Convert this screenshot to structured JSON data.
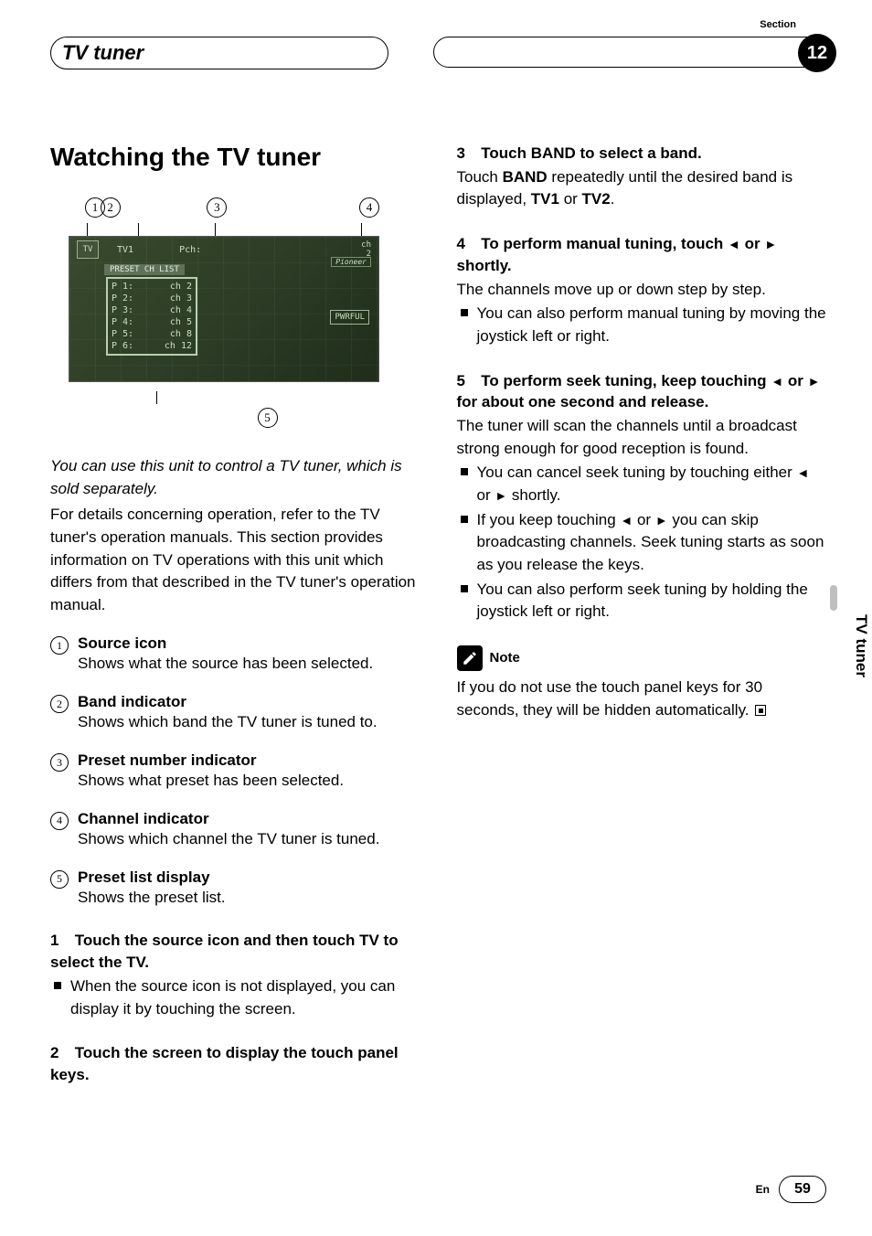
{
  "header": {
    "title": "TV tuner",
    "section_label": "Section",
    "section_number": "12"
  },
  "side_tab": "TV tuner",
  "col_left": {
    "heading": "Watching the TV tuner",
    "callouts_top": [
      "1",
      "2",
      "3",
      "4"
    ],
    "callout_bottom": "5",
    "screen": {
      "icon_label": "TV",
      "band": "TV1",
      "pch": "Pch:",
      "ch_label": "ch",
      "ch_value": "2",
      "brand": "Pioneer",
      "list_label": "PRESET CH LIST",
      "pwrful": "PWRFUL",
      "presets": [
        {
          "p": "P 1:",
          "ch": "ch   2"
        },
        {
          "p": "P 2:",
          "ch": "ch   3"
        },
        {
          "p": "P 3:",
          "ch": "ch   4"
        },
        {
          "p": "P 4:",
          "ch": "ch   5"
        },
        {
          "p": "P 5:",
          "ch": "ch   8"
        },
        {
          "p": "P 6:",
          "ch": "ch  12"
        }
      ]
    },
    "intro_italic": "You can use this unit to control a TV tuner, which is sold separately.",
    "intro_body": "For details concerning operation, refer to the TV tuner's operation manuals. This section provides information on TV operations with this unit which differs from that described in the TV tuner's operation manual.",
    "defs": [
      {
        "n": "1",
        "t": "Source icon",
        "d": "Shows what the source has been selected."
      },
      {
        "n": "2",
        "t": "Band indicator",
        "d": "Shows which band the TV tuner is tuned to."
      },
      {
        "n": "3",
        "t": "Preset number indicator",
        "d": "Shows what preset has been selected."
      },
      {
        "n": "4",
        "t": "Channel indicator",
        "d": "Shows which channel the TV tuner is tuned."
      },
      {
        "n": "5",
        "t": "Preset list display",
        "d": "Shows the preset list."
      }
    ],
    "step1_heading_a": "1",
    "step1_heading_b": "Touch the source icon and then touch TV to select the TV.",
    "step1_bullet": "When the source icon is not displayed, you can display it by touching the screen.",
    "step2_heading_a": "2",
    "step2_heading_b": "Touch the screen to display the touch panel keys."
  },
  "col_right": {
    "step3_heading_a": "3",
    "step3_heading_b": "Touch BAND to select a band.",
    "step3_body_a": "Touch ",
    "step3_body_b": "BAND",
    "step3_body_c": " repeatedly until the desired band is displayed, ",
    "step3_body_d": "TV1",
    "step3_body_e": " or ",
    "step3_body_f": "TV2",
    "step3_body_g": ".",
    "step4_heading_a": "4",
    "step4_heading_b_pre": "To perform manual tuning, touch ",
    "step4_heading_b_post": " shortly.",
    "step4_body": "The channels move up or down step by step.",
    "step4_bullet": "You can also perform manual tuning by moving the joystick left or right.",
    "step5_heading_a": "5",
    "step5_heading_b_pre": "To perform seek tuning, keep touching ",
    "step5_heading_b_post": " for about one second and release.",
    "step5_body": "The tuner will scan the channels until a broadcast strong enough for good reception is found.",
    "step5_bullet1_pre": "You can cancel seek tuning by touching either ",
    "step5_bullet1_post": " shortly.",
    "step5_bullet2_pre": "If you keep touching ",
    "step5_bullet2_post": " you can skip broadcasting channels. Seek tuning starts as soon as you release the keys.",
    "step5_bullet3": "You can also perform seek tuning by holding the joystick left or right.",
    "note_label": "Note",
    "note_text": "If you do not use the touch panel keys for 30 seconds, they will be hidden automatically."
  },
  "glyphs": {
    "tri_left": "◄",
    "tri_right": "►",
    "or": " or "
  },
  "footer": {
    "lang": "En",
    "page": "59"
  }
}
